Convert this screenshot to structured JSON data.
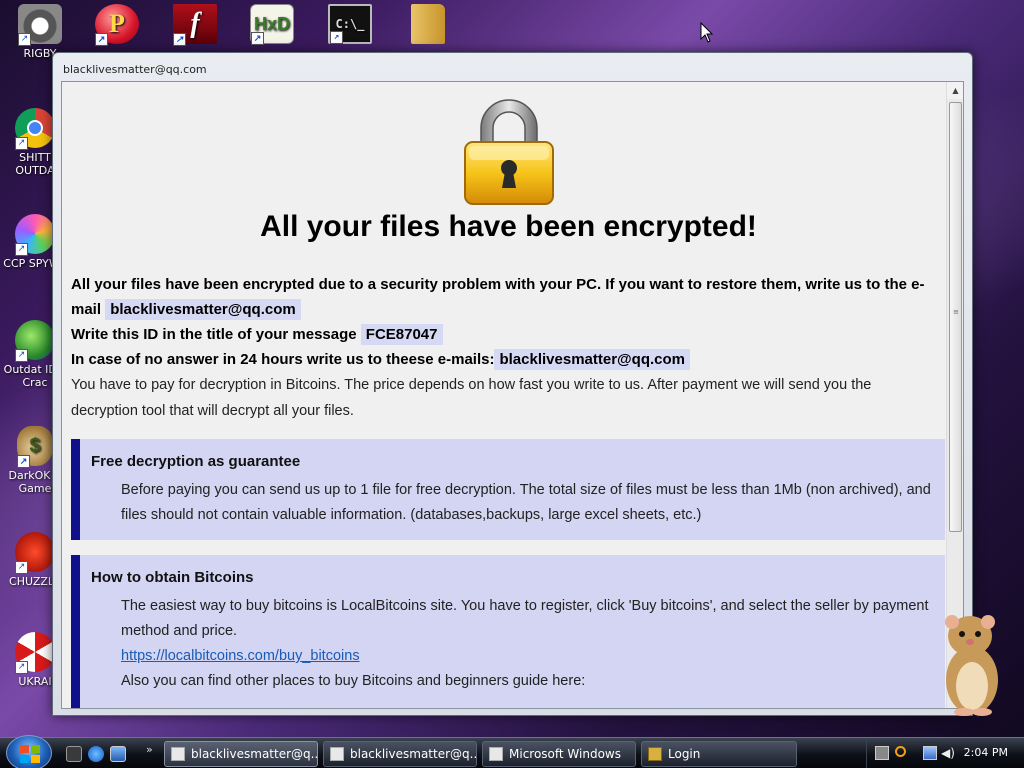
{
  "desktop": {
    "icons": [
      {
        "label": "RIGBY"
      },
      {
        "label": ""
      },
      {
        "label": ""
      },
      {
        "label": ""
      },
      {
        "label": ""
      },
      {
        "label": ""
      },
      {
        "label": "SHITT OUTDA"
      },
      {
        "label": "CCP SPYWA"
      },
      {
        "label": "Outdat IDM Crac"
      },
      {
        "label": "DarkOK V Game"
      },
      {
        "label": "CHUZZLE"
      },
      {
        "label": "UKRAI"
      }
    ]
  },
  "window": {
    "title": "blacklivesmatter@qq.com",
    "heading": "All your files have been encrypted!",
    "p1_text": "All your files have been encrypted due to a security problem with your PC. If you want to restore them, write us to the e-mail",
    "p1_email": "blacklivesmatter@qq.com",
    "p2_text": "Write this ID in the title of your message",
    "p2_id": "FCE87047",
    "p3_text": "In case of no answer in 24 hours write us to theese e-mails:",
    "p3_email": "blacklivesmatter@qq.com",
    "p4_text": "You have to pay for decryption in Bitcoins. The price depends on how fast you write to us. After payment we will send you the decryption tool that will decrypt all your files.",
    "box1": {
      "title": "Free decryption as guarantee",
      "text": "Before paying you can send us up to 1 file for free decryption. The total size of files must be less than 1Mb (non archived), and files should not contain valuable information. (databases,backups, large excel sheets, etc.)"
    },
    "box2": {
      "title": "How to obtain Bitcoins",
      "text": "The easiest way to buy bitcoins is LocalBitcoins site. You have to register, click 'Buy bitcoins', and select the seller by payment method and price.",
      "link": "https://localbitcoins.com/buy_bitcoins",
      "text2": "Also you can find other places to buy Bitcoins and beginners guide here:"
    }
  },
  "taskbar": {
    "buttons": [
      {
        "label": "blacklivesmatter@q..."
      },
      {
        "label": "blacklivesmatter@q..."
      },
      {
        "label": "Microsoft Windows"
      },
      {
        "label": "Login"
      }
    ],
    "chevron": "»",
    "clock": "2:04 PM"
  },
  "colors": {
    "accent_bar": "#10108a",
    "box_bg": "#d3d5f2",
    "highlight": "#d6d9f4",
    "link": "#1a5bb5"
  }
}
